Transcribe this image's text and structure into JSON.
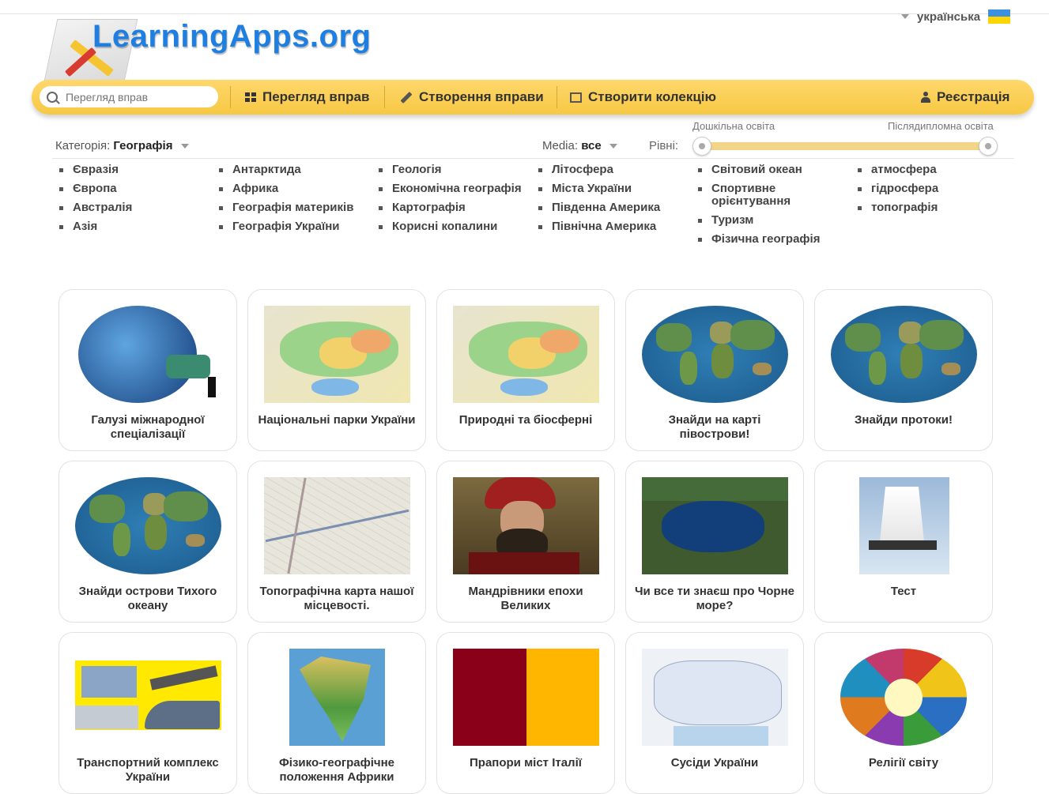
{
  "header": {
    "logo_text": "LearningApps.org",
    "language": "українська"
  },
  "nav": {
    "search_placeholder": "Перегляд вправ",
    "browse": "Перегляд вправ",
    "create": "Створення вправи",
    "collection": "Створити колекцію",
    "register": "Реєстрація"
  },
  "filters": {
    "category_label": "Категорія:",
    "category_value": "Географія",
    "media_label": "Media:",
    "media_value": "все",
    "levels_label": "Рівні:",
    "level_min": "Дошкільна освіта",
    "level_max": "Післядипломна освіта",
    "level_range": [
      0,
      1
    ]
  },
  "subcategories": [
    [
      "Євразія",
      "Європа",
      "Австралія",
      "Азія"
    ],
    [
      "Антарктида",
      "Африка",
      "Географія материків",
      "Географія України"
    ],
    [
      "Геологія",
      "Економічна географія",
      "Картографія",
      "Корисні копалини"
    ],
    [
      "Літосфера",
      "Міста України",
      "Південна Америка",
      "Північна Америка"
    ],
    [
      "Світовий океан",
      "Спортивне орієнтування",
      "Туризм",
      "Фізична географія"
    ],
    [
      "атмосфера",
      "гідросфера",
      "топографія"
    ]
  ],
  "apps": [
    {
      "title": "Галузі міжнародної спеціалізації",
      "thumb": "earth-faucet"
    },
    {
      "title": "Національні парки України",
      "thumb": "ukraine-map"
    },
    {
      "title": "Природні та біосферні",
      "thumb": "ukraine-map"
    },
    {
      "title": "Знайди на карті півострови!",
      "thumb": "world-globe"
    },
    {
      "title": "Знайди протоки!",
      "thumb": "world-globe"
    },
    {
      "title": "Знайди острови Тихого океану",
      "thumb": "world-globe"
    },
    {
      "title": "Топографічна карта нашої місцевості.",
      "thumb": "topo-map"
    },
    {
      "title": "Мандрівники епохи Великих",
      "thumb": "explorer-portrait"
    },
    {
      "title": "Чи все ти знаєш про Чорне море?",
      "thumb": "black-sea"
    },
    {
      "title": "Тест",
      "thumb": "sailing-ship"
    },
    {
      "title": "Транспортний комплекс України",
      "thumb": "transport"
    },
    {
      "title": "Фізико-географічне положення Африки",
      "thumb": "africa-map"
    },
    {
      "title": "Прапори міст Італії",
      "thumb": "italy-flag"
    },
    {
      "title": "Сусіди України",
      "thumb": "ukraine-outline"
    },
    {
      "title": "Релігії світу",
      "thumb": "religion-symbols"
    }
  ],
  "colors": {
    "nav_bar": "#f7c844",
    "logo_blue": "#1f7fe0"
  }
}
